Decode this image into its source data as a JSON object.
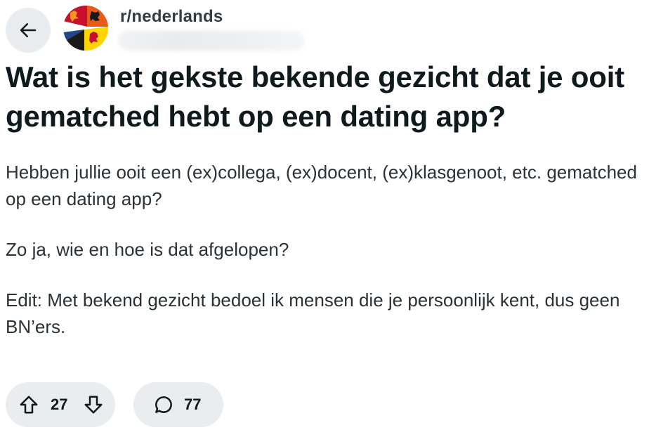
{
  "header": {
    "back_icon": "arrow-left-icon",
    "subreddit": "r/nederlands",
    "avatar_icon": "subreddit-flag-lion-icon",
    "colors": {
      "flag_red": "#c8102e",
      "flag_white": "#ffffff",
      "flag_blue": "#21468b",
      "flag_orange": "#f7931e",
      "flag_black": "#1a1a1a",
      "flag_yellow": "#ffd400"
    }
  },
  "post": {
    "title": "Wat is het gekste bekende gezicht dat je ooit gematched hebt op een dating app?",
    "paragraphs": [
      "Hebben jullie ooit een (ex)collega, (ex)docent, (ex)klasgenoot, etc. gematched op een dating app?",
      "Zo ja, wie en hoe is dat afgelopen?",
      "Edit: Met bekend gezicht bedoel ik mensen die je persoonlijk kent, dus geen BN’ers."
    ]
  },
  "actions": {
    "upvote_icon": "upvote-arrow-icon",
    "vote_count": "27",
    "downvote_icon": "downvote-arrow-icon",
    "comment_icon": "comment-bubble-icon",
    "comment_count": "77",
    "pill_color": "#eaedef"
  }
}
